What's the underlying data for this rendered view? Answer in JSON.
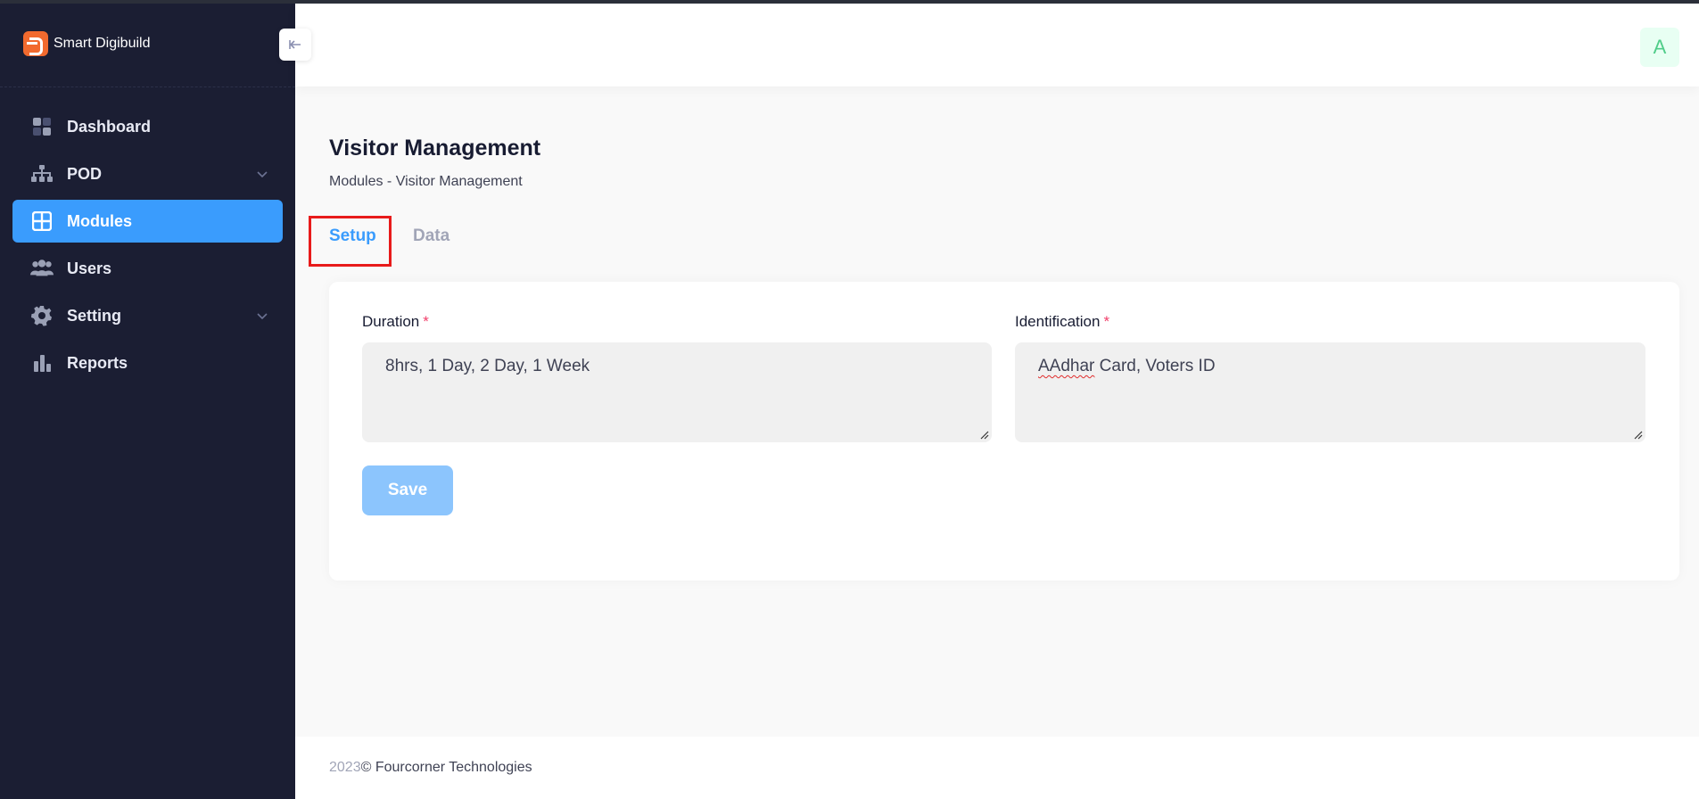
{
  "app": {
    "brand_name": "Smart Digibuild"
  },
  "sidebar": {
    "items": [
      {
        "label": "Dashboard",
        "icon": "dashboard-icon",
        "has_submenu": false,
        "active": false
      },
      {
        "label": "POD",
        "icon": "sitemap-icon",
        "has_submenu": true,
        "active": false
      },
      {
        "label": "Modules",
        "icon": "grid-icon",
        "has_submenu": false,
        "active": true
      },
      {
        "label": "Users",
        "icon": "users-icon",
        "has_submenu": false,
        "active": false
      },
      {
        "label": "Setting",
        "icon": "gear-icon",
        "has_submenu": true,
        "active": false
      },
      {
        "label": "Reports",
        "icon": "bar-chart-icon",
        "has_submenu": false,
        "active": false
      }
    ]
  },
  "header": {
    "avatar_initial": "A"
  },
  "page": {
    "title": "Visitor Management",
    "breadcrumb": "Modules - Visitor Management"
  },
  "tabs": [
    {
      "label": "Setup",
      "active": true
    },
    {
      "label": "Data",
      "active": false
    }
  ],
  "form": {
    "duration": {
      "label": "Duration",
      "required_mark": "*",
      "value": "8hrs, 1 Day, 2 Day, 1 Week"
    },
    "identification": {
      "label": "Identification",
      "required_mark": "*",
      "value_flagged": "AAdhar",
      "value_rest": " Card, Voters ID"
    },
    "save_label": "Save"
  },
  "footer": {
    "year": "2023",
    "company": "© Fourcorner Technologies"
  },
  "colors": {
    "sidebar_bg": "#1b1e33",
    "accent": "#3a9cfd",
    "save_disabled": "#8cc5fd",
    "highlight_box": "#e81b1b",
    "avatar_text": "#50cd89"
  }
}
